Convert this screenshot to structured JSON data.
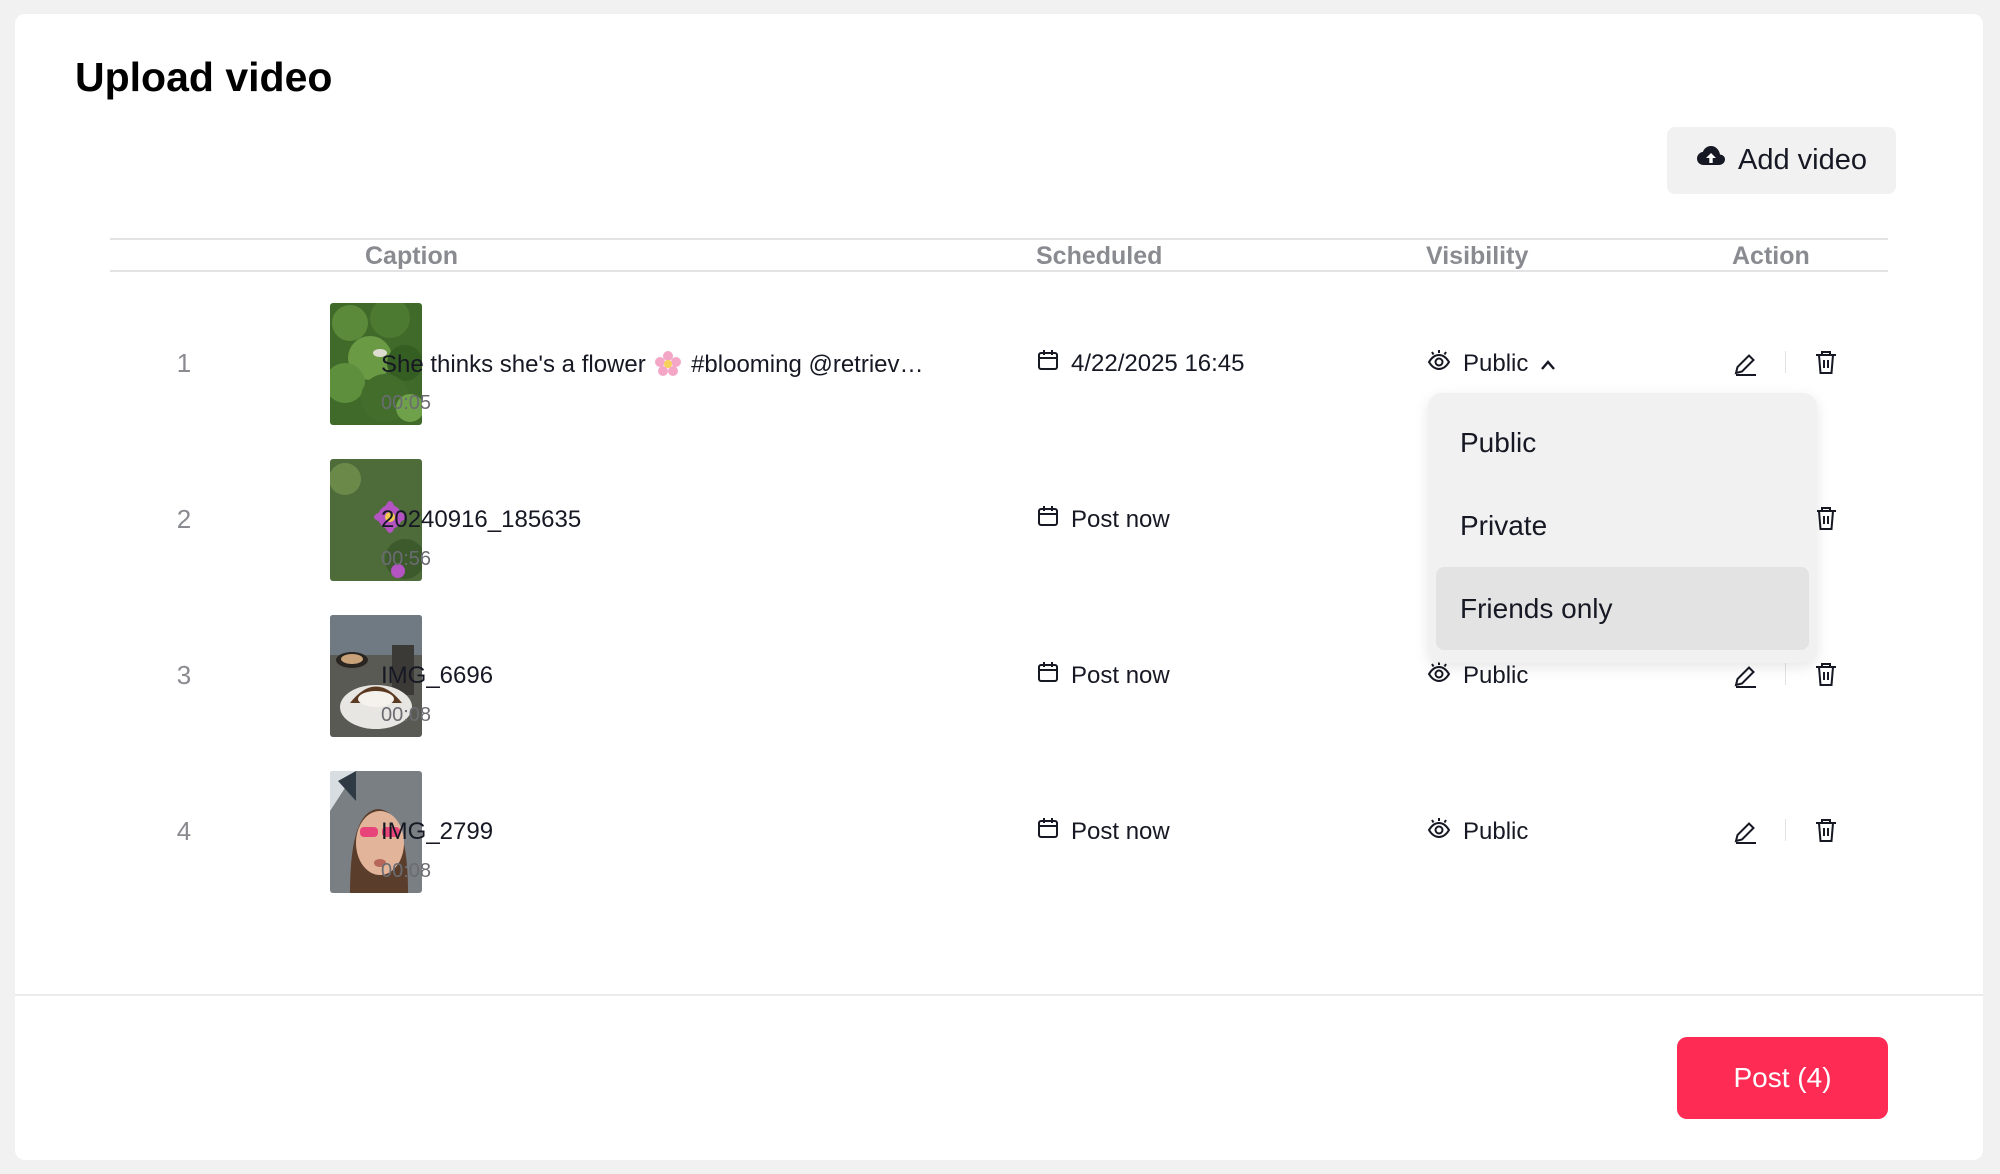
{
  "page": {
    "title": "Upload video"
  },
  "toolbar": {
    "add_video_label": "Add video",
    "add_video_icon": "cloud-upload-icon"
  },
  "table": {
    "columns": {
      "caption": "Caption",
      "scheduled": "Scheduled",
      "visibility": "Visibility",
      "action": "Action"
    },
    "rows": [
      {
        "index": "1",
        "caption_before": "She thinks she's a flower",
        "caption_emoji": "flower-emoji",
        "caption_after": "#blooming @retriev…",
        "duration": "00:05",
        "scheduled": "4/22/2025 16:45",
        "visibility": "Public",
        "dropdown_open": true
      },
      {
        "index": "2",
        "caption": "20240916_185635",
        "duration": "00:56",
        "scheduled": "Post now"
      },
      {
        "index": "3",
        "caption": "IMG_6696",
        "duration": "00:08",
        "scheduled": "Post now",
        "visibility": "Public"
      },
      {
        "index": "4",
        "caption": "IMG_2799",
        "duration": "00:08",
        "scheduled": "Post now",
        "visibility": "Public"
      }
    ]
  },
  "visibility_dropdown": {
    "options": [
      "Public",
      "Private",
      "Friends only"
    ],
    "highlighted": "Friends only"
  },
  "footer": {
    "post_label": "Post (4)"
  },
  "colors": {
    "accent": "#fe2c55",
    "muted_text": "#8a8b91",
    "surface": "#f1f1f2"
  }
}
